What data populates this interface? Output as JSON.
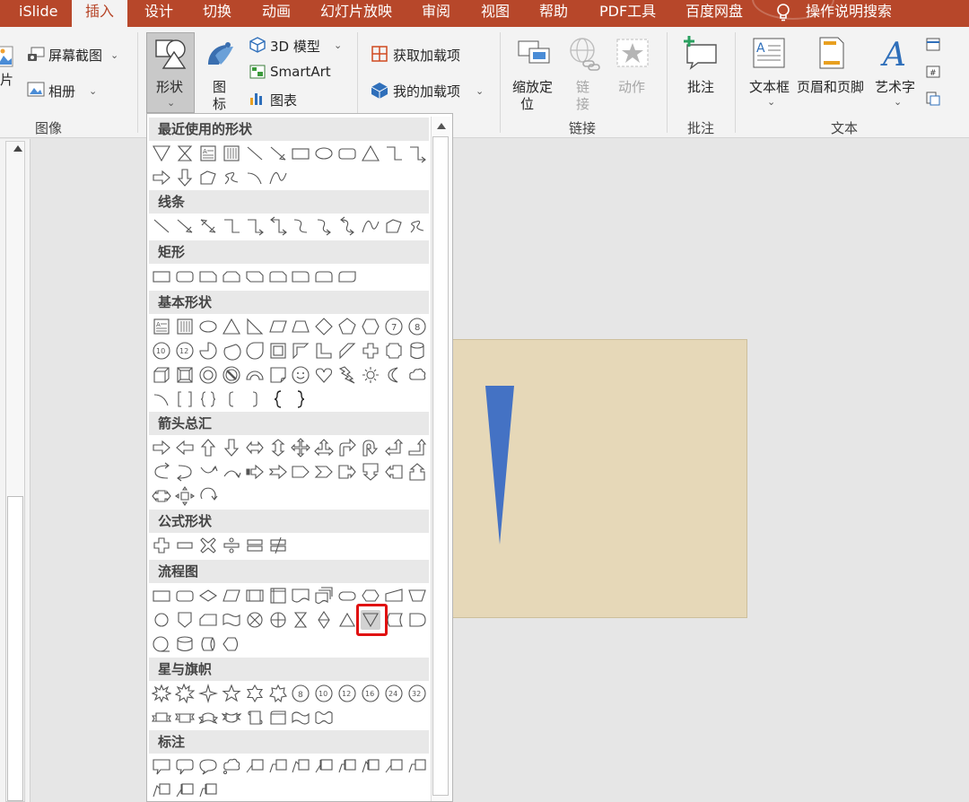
{
  "tabs": [
    {
      "label": "iSlide",
      "active": false
    },
    {
      "label": "插入",
      "active": true
    },
    {
      "label": "设计",
      "active": false
    },
    {
      "label": "切换",
      "active": false
    },
    {
      "label": "动画",
      "active": false
    },
    {
      "label": "幻灯片放映",
      "active": false
    },
    {
      "label": "审阅",
      "active": false
    },
    {
      "label": "视图",
      "active": false
    },
    {
      "label": "帮助",
      "active": false
    },
    {
      "label": "PDF工具",
      "active": false
    },
    {
      "label": "百度网盘",
      "active": false
    }
  ],
  "tell_me": {
    "label": "操作说明搜索",
    "icon": "lightbulb-icon"
  },
  "ribbon": {
    "image": {
      "partial_label": "片",
      "screenshot": "屏幕截图",
      "album": "相册",
      "group": "图像"
    },
    "illustrations": {
      "shapes": "形状",
      "icons_line1": "图",
      "icons_line2": "标",
      "model3d": "3D 模型",
      "smartart": "SmartArt",
      "chart": "图表"
    },
    "addins": {
      "get": "获取加载项",
      "my": "我的加载项"
    },
    "links": {
      "zoom_line1": "缩放定",
      "zoom_line2": "位",
      "link_line1": "链",
      "link_line2": "接",
      "action": "动作",
      "group": "链接"
    },
    "comments": {
      "comment": "批注",
      "group": "批注"
    },
    "text": {
      "textbox": "文本框",
      "header_footer": "页眉和页脚",
      "wordart": "艺术字",
      "group": "文本"
    }
  },
  "shapes_panel": {
    "categories": [
      {
        "label": "最近使用的形状",
        "shapes": [
          "triangle-down",
          "hourglass",
          "text-box",
          "vertical-text-box",
          "line",
          "arrow-line",
          "rectangle",
          "oval",
          "rounded-rectangle",
          "triangle",
          "elbow-connector",
          "elbow-arrow",
          "right-arrow",
          "down-arrow",
          "freeform",
          "scribble",
          "arc",
          "curve"
        ]
      },
      {
        "label": "线条",
        "shapes": [
          "line",
          "arrow-line",
          "double-arrow-line",
          "elbow-connector",
          "elbow-arrow",
          "elbow-double-arrow",
          "curved-connector",
          "curved-arrow",
          "curved-double-arrow",
          "curve",
          "freeform",
          "scribble"
        ]
      },
      {
        "label": "矩形",
        "shapes": [
          "rectangle",
          "rounded-rectangle",
          "snip-single-corner",
          "snip-same-side",
          "snip-diagonal",
          "snip-round",
          "round-single-corner",
          "round-same-side",
          "round-diagonal"
        ]
      },
      {
        "label": "基本形状",
        "shapes": [
          "text-box",
          "vertical-text-box",
          "oval",
          "triangle",
          "right-triangle",
          "parallelogram",
          "trapezoid",
          "diamond",
          "pentagon",
          "hexagon",
          "heptagon",
          "octagon",
          "decagon",
          "dodecagon",
          "pie",
          "chord",
          "teardrop",
          "frame",
          "half-frame",
          "l-shape",
          "diagonal-stripe",
          "cross",
          "plaque",
          "can",
          "cube",
          "bevel",
          "donut",
          "no-symbol",
          "block-arc",
          "folded-corner",
          "smiley-face",
          "heart",
          "lightning-bolt",
          "sun",
          "moon",
          "cloud",
          "arc",
          "double-bracket",
          "double-brace",
          "left-bracket",
          "right-bracket",
          "left-brace",
          "right-brace"
        ]
      },
      {
        "label": "箭头总汇",
        "shapes": [
          "right-arrow",
          "left-arrow",
          "up-arrow",
          "down-arrow",
          "left-right-arrow",
          "up-down-arrow",
          "quad-arrow",
          "left-right-up-arrow",
          "bent-arrow",
          "u-turn-arrow",
          "left-up-arrow",
          "bent-up-arrow",
          "curved-right-arrow",
          "curved-left-arrow",
          "curved-up-arrow",
          "curved-down-arrow",
          "striped-right-arrow",
          "notched-right-arrow",
          "pentagon-arrow",
          "chevron",
          "right-arrow-callout",
          "down-arrow-callout",
          "left-arrow-callout",
          "up-arrow-callout",
          "left-right-arrow-callout",
          "quad-arrow-callout",
          "circular-arrow"
        ]
      },
      {
        "label": "公式形状",
        "shapes": [
          "plus",
          "minus",
          "multiply",
          "division",
          "equal",
          "not-equal"
        ]
      },
      {
        "label": "流程图",
        "shapes": [
          "process",
          "alternate-process",
          "decision",
          "data",
          "predefined-process",
          "internal-storage",
          "document",
          "multidocument",
          "terminator",
          "preparation",
          "manual-input",
          "manual-operation",
          "connector",
          "off-page-connector",
          "card",
          "punched-tape",
          "summing-junction",
          "or",
          "collate",
          "sort",
          "extract",
          "merge",
          "stored-data",
          "delay",
          "sequential-access-storage",
          "magnetic-disk",
          "direct-access-storage",
          "display"
        ]
      },
      {
        "label": "星与旗帜",
        "shapes": [
          "explosion-1",
          "explosion-2",
          "star-4",
          "star-5",
          "star-6",
          "star-7",
          "star-8",
          "star-10",
          "star-12",
          "star-16",
          "star-24",
          "star-32",
          "ribbon-up",
          "ribbon-down",
          "curved-ribbon-up",
          "curved-ribbon-down",
          "vertical-scroll",
          "horizontal-scroll",
          "wave",
          "double-wave"
        ]
      },
      {
        "label": "标注",
        "shapes": [
          "rectangular-callout",
          "rounded-rectangular-callout",
          "oval-callout",
          "cloud-callout",
          "line-callout-1",
          "line-callout-2",
          "line-callout-3",
          "line-callout-1-accent",
          "line-callout-2-accent",
          "line-callout-3-accent",
          "line-callout-1-border",
          "line-callout-2-border",
          "line-callout-3-border",
          "line-callout-1-border-accent",
          "line-callout-2-border-accent"
        ]
      }
    ],
    "selected_shape": "merge"
  },
  "slide": {
    "background_color": "#e6d8b8",
    "shape": "triangle-down",
    "shape_color": "#4472c4"
  },
  "colors": {
    "tab_bar": "#b7472a",
    "ribbon": "#f3f3f3",
    "highlight_box": "#e01010"
  }
}
